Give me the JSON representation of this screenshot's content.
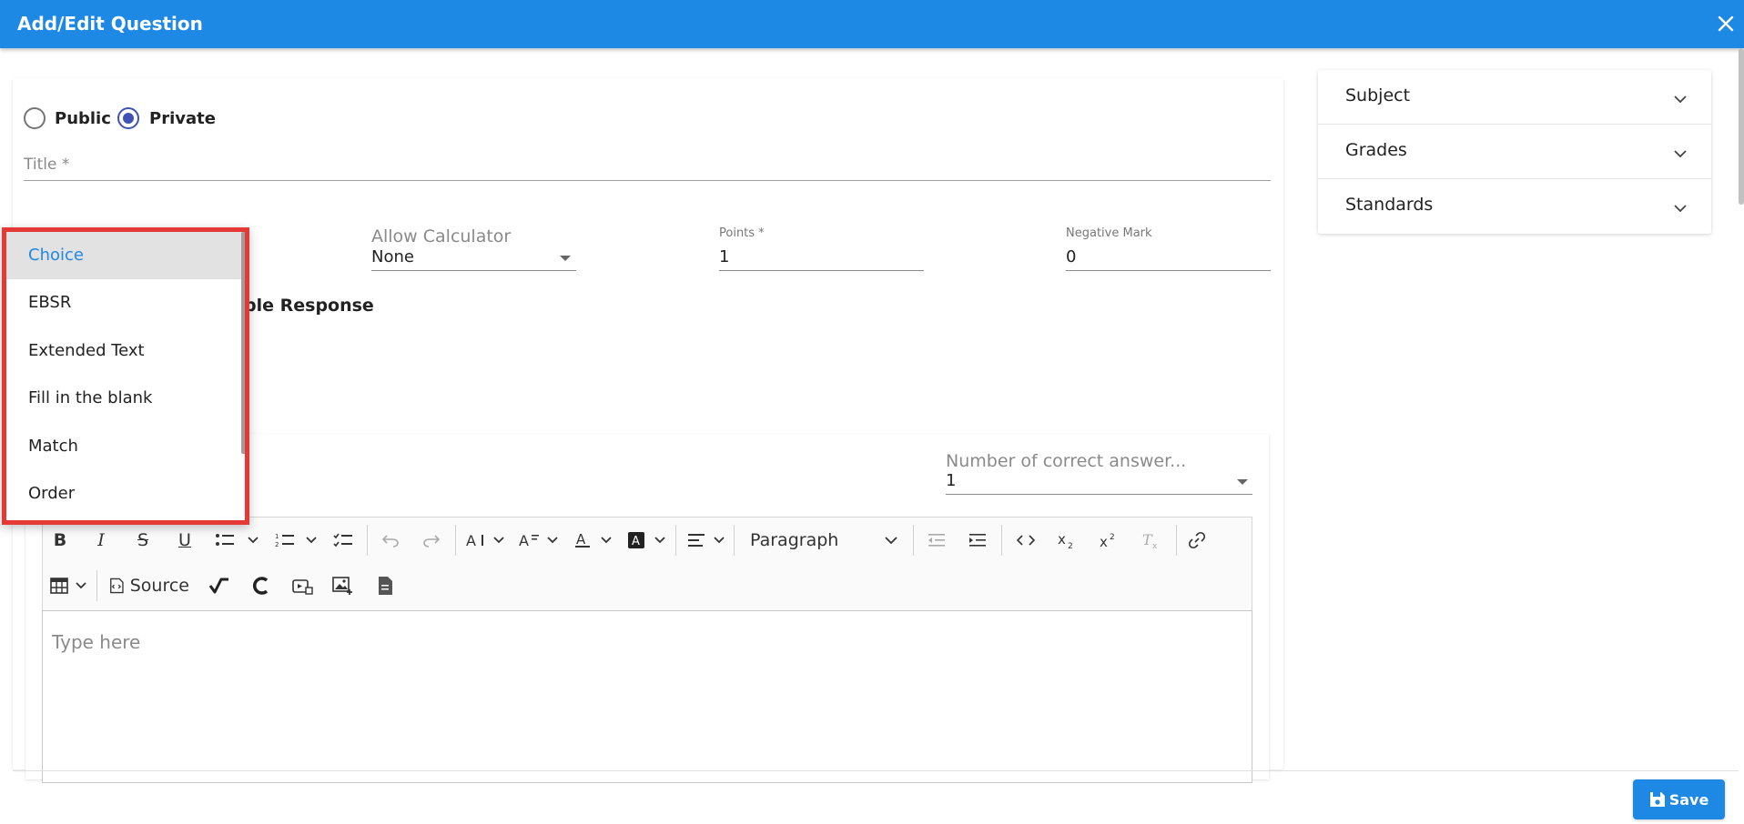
{
  "header": {
    "title": "Add/Edit Question"
  },
  "visibility": {
    "options": [
      {
        "label": "Public",
        "checked": false
      },
      {
        "label": "Private",
        "checked": true
      }
    ]
  },
  "title_field": {
    "label": "Title *",
    "value": ""
  },
  "calculator": {
    "label": "Allow Calculator",
    "value": "None"
  },
  "points": {
    "label": "Points *",
    "value": "1"
  },
  "negative_mark": {
    "label": "Negative Mark",
    "value": "0"
  },
  "partial_text": "ple Response",
  "correct_answers": {
    "label": "Number of correct answer...",
    "value": "1"
  },
  "editor": {
    "paragraph_select": "Paragraph",
    "source_label": "Source",
    "placeholder": "Type here"
  },
  "side_panel": {
    "items": [
      {
        "label": "Subject"
      },
      {
        "label": "Grades"
      },
      {
        "label": "Standards"
      }
    ]
  },
  "question_type_menu": {
    "items": [
      {
        "label": "Choice",
        "selected": true
      },
      {
        "label": "EBSR",
        "selected": false
      },
      {
        "label": "Extended Text",
        "selected": false
      },
      {
        "label": "Fill in the blank",
        "selected": false
      },
      {
        "label": "Match",
        "selected": false
      },
      {
        "label": "Order",
        "selected": false
      }
    ]
  },
  "footer": {
    "save_label": "Save"
  },
  "colors": {
    "header": "#1e88e5",
    "radio_accent": "#3f51b5",
    "selected_menu_text": "#1e88e5",
    "highlight_border": "#e53935",
    "save_button": "#1e88e5"
  },
  "icons": {
    "close": "close-icon",
    "chevron": "chevron-down-icon",
    "save": "floppy-disk-icon"
  }
}
